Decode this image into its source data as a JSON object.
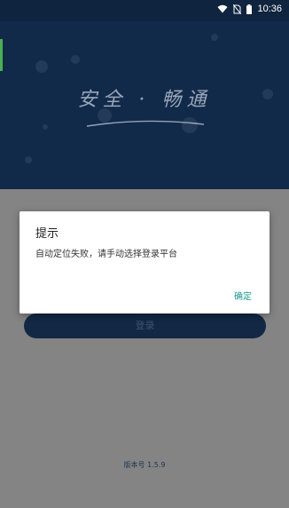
{
  "status_bar": {
    "time": "10:36",
    "icons": [
      "wifi-icon",
      "no-sim-icon",
      "battery-icon"
    ]
  },
  "hero": {
    "slogan": "安全 · 畅通"
  },
  "login": {
    "button_label": "登录"
  },
  "footer": {
    "version": "版本号 1.5.9"
  },
  "dialog": {
    "title": "提示",
    "message": "自动定位失败，请手动选择登录平台",
    "confirm_label": "确定"
  },
  "colors": {
    "hero_bg": "#112a4a",
    "overlay": "#848484",
    "accent": "#1a9a8a",
    "button_bg": "#122845"
  }
}
